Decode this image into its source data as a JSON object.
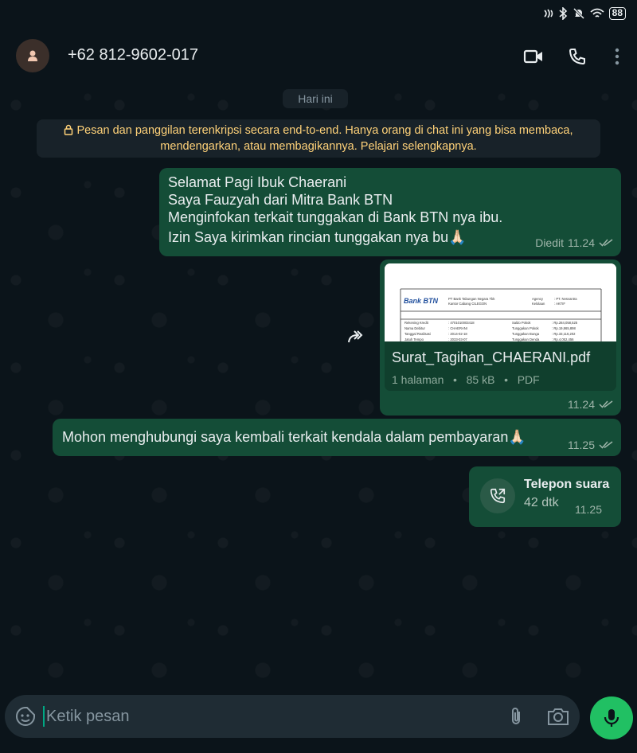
{
  "status_bar": {
    "battery": "88"
  },
  "header": {
    "contact_name": "+62 812-9602-017"
  },
  "chat": {
    "date_chip": "Hari ini",
    "encryption_notice": "Pesan dan panggilan terenkripsi secara end-to-end. Hanya orang di chat ini yang bisa membaca, mendengarkan, atau membagikannya. Pelajari selengkapnya.",
    "messages": [
      {
        "lines": [
          "Selamat Pagi Ibuk Chaerani",
          "Saya Fauzyah dari Mitra Bank BTN",
          "Menginfokan terkait tunggakan di Bank BTN nya ibu.",
          "Izin Saya kirimkan rincian tunggakan nya bu🙏🏻"
        ],
        "status": "Diedit",
        "time": "11.24"
      },
      {
        "document": {
          "filename": "Surat_Tagihan_CHAERANI.pdf",
          "pages": "1 halaman",
          "size": "85 kB",
          "type": "PDF",
          "preview": {
            "bank_logo": "Bank BTN",
            "bank_name": "PT Bank Tabungan Negara Tbk",
            "branch": "Kantor Cabang CILEGON",
            "agency_label": "Agency",
            "agency_value": ": PT. Nesvantra",
            "kolektor_label": "Kelolaan",
            "kolektor_value": ": AKTIF",
            "rows": [
              [
                "Rekening Kredit",
                ": 4701010003418",
                "Saldo Pokok",
                ": Rp.284,058,525"
              ],
              [
                "Nama Debitur",
                ": CHAERANI",
                "Tunggakan Pokok",
                ": Rp.19,865,898"
              ],
              [
                "Tanggal Realisasi",
                ": 2014-02-18",
                "Tunggakan Bunga",
                ": Rp.33,116,202"
              ],
              [
                "Jatuh Tempo",
                ": 2033-03-07",
                "Tunggakan Denda",
                ": Rp.4,052,456"
              ]
            ]
          }
        },
        "time": "11.24"
      },
      {
        "text": "Mohon menghubungi saya kembali terkait kendala dalam pembayaran🙏🏻",
        "time": "11.25"
      },
      {
        "call": {
          "title": "Telepon suara",
          "duration": "42 dtk"
        },
        "time": "11.25"
      }
    ]
  },
  "composer": {
    "placeholder": "Ketik pesan"
  },
  "colors": {
    "bubble": "#144d37",
    "accent": "#21c063",
    "notice": "#ffd279"
  }
}
